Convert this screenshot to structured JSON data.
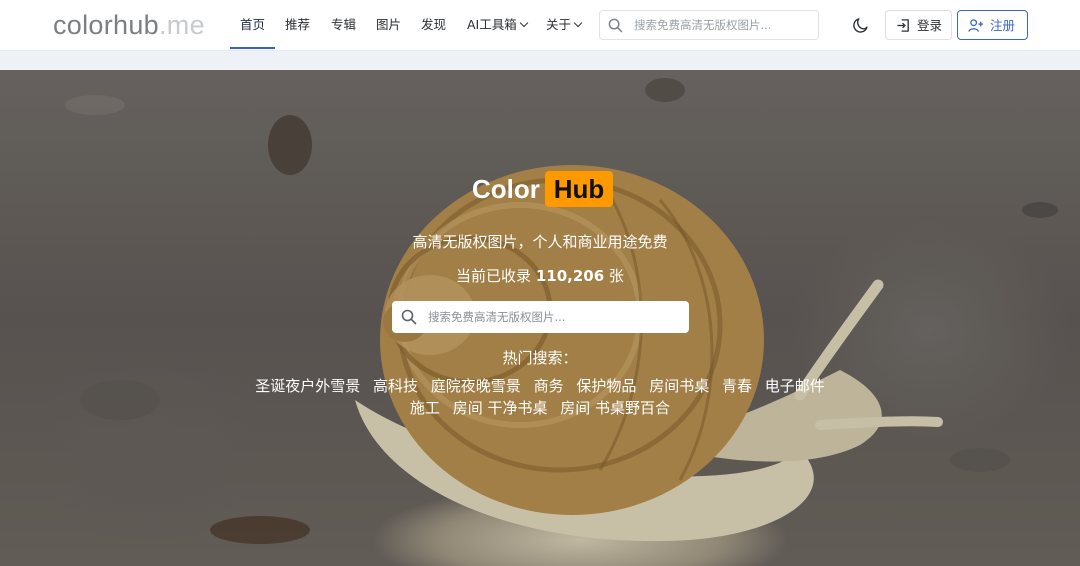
{
  "nav": {
    "logo_main": "colorhub",
    "logo_tld": ".me",
    "items": [
      "首页",
      "推荐",
      "专辑",
      "图片",
      "发现"
    ],
    "ai_tools": "AI工具箱",
    "about": "关于",
    "search_placeholder": "搜索免费高清无版权图片...",
    "login": "登录",
    "register": "注册"
  },
  "hero": {
    "brand_color": "Color",
    "brand_hub": "Hub",
    "tagline": "高清无版权图片，个人和商业用途免费",
    "count_prefix": "当前已收录 ",
    "count_value": "110,206",
    "count_suffix": " 张",
    "search_placeholder": "搜索免费高清无版权图片...",
    "hot_title": "热门搜索：",
    "hot_tags": [
      "圣诞夜户外雪景",
      "高科技",
      "庭院夜晚雪景",
      "商务",
      "保护物品",
      "房间书桌",
      "青春",
      "电子邮件",
      "施工",
      "房间 干净书桌",
      "房间 书桌野百合"
    ]
  },
  "colors": {
    "accent_blue": "#3a66c8",
    "brand_orange": "#ff9900"
  }
}
